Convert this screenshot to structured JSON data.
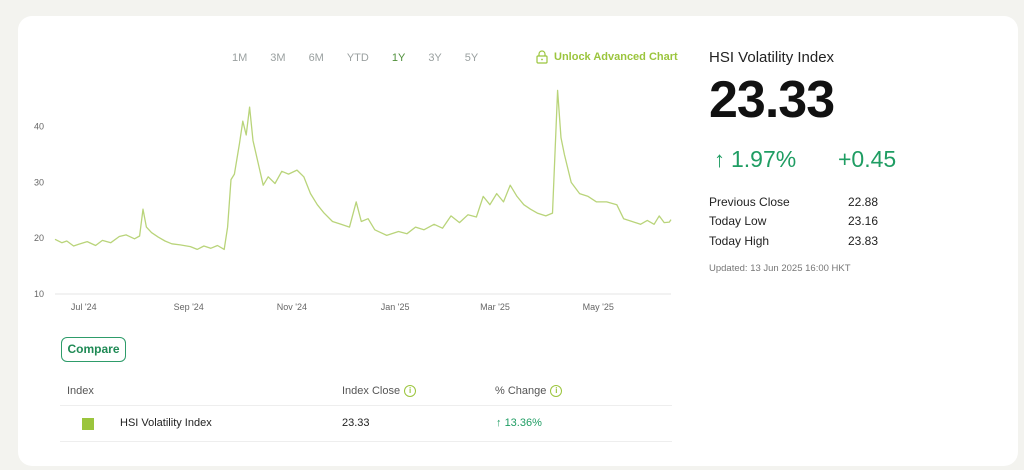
{
  "ranges": {
    "items": [
      "1M",
      "3M",
      "6M",
      "YTD",
      "1Y",
      "3Y",
      "5Y"
    ],
    "active": "1Y"
  },
  "unlock": {
    "label": "Unlock Advanced Chart",
    "icon": "lock-icon"
  },
  "compare": {
    "label": "Compare"
  },
  "table": {
    "headers": {
      "index": "Index",
      "close": "Index Close",
      "change": "% Change"
    },
    "row": {
      "name": "HSI Volatility Index",
      "close": "23.33",
      "change": "13.36%"
    }
  },
  "quote": {
    "title": "HSI Volatility Index",
    "value": "23.33",
    "change_pct": "1.97%",
    "change_abs": "+0.45",
    "stats": [
      {
        "label": "Previous Close",
        "value": "22.88"
      },
      {
        "label": "Today Low",
        "value": "23.16"
      },
      {
        "label": "Today High",
        "value": "23.83"
      }
    ],
    "updated": "Updated: 13 Jun 2025 16:00 HKT"
  },
  "colors": {
    "accent": "#9bc53d",
    "up": "#1f9d63",
    "active_range": "#4f8f3a"
  },
  "chart_data": {
    "type": "line",
    "title": "",
    "xlabel": "",
    "ylabel": "",
    "ylim": [
      10,
      48
    ],
    "xlim": [
      "2024-06-14",
      "2025-06-13"
    ],
    "yticks": [
      "10",
      "20",
      "30",
      "40"
    ],
    "xticks": [
      {
        "label": "Jul '24",
        "date": "2024-07-01"
      },
      {
        "label": "Sep '24",
        "date": "2024-09-01"
      },
      {
        "label": "Nov '24",
        "date": "2024-11-01"
      },
      {
        "label": "Jan '25",
        "date": "2025-01-01"
      },
      {
        "label": "Mar '25",
        "date": "2025-03-01"
      },
      {
        "label": "May '25",
        "date": "2025-05-01"
      }
    ],
    "series": [
      {
        "color": "#b9d47a",
        "points": [
          [
            "2024-06-14",
            19.8
          ],
          [
            "2024-06-18",
            19.2
          ],
          [
            "2024-06-21",
            19.5
          ],
          [
            "2024-06-25",
            18.6
          ],
          [
            "2024-06-28",
            18.9
          ],
          [
            "2024-07-03",
            19.4
          ],
          [
            "2024-07-08",
            18.7
          ],
          [
            "2024-07-12",
            19.6
          ],
          [
            "2024-07-17",
            19.2
          ],
          [
            "2024-07-22",
            20.3
          ],
          [
            "2024-07-26",
            20.6
          ],
          [
            "2024-07-31",
            19.9
          ],
          [
            "2024-08-03",
            20.4
          ],
          [
            "2024-08-05",
            25.2
          ],
          [
            "2024-08-07",
            22.0
          ],
          [
            "2024-08-10",
            21.0
          ],
          [
            "2024-08-14",
            20.2
          ],
          [
            "2024-08-18",
            19.5
          ],
          [
            "2024-08-22",
            19.0
          ],
          [
            "2024-08-27",
            18.8
          ],
          [
            "2024-09-02",
            18.5
          ],
          [
            "2024-09-06",
            18.0
          ],
          [
            "2024-09-10",
            18.6
          ],
          [
            "2024-09-14",
            18.2
          ],
          [
            "2024-09-18",
            18.7
          ],
          [
            "2024-09-22",
            18.0
          ],
          [
            "2024-09-24",
            22.0
          ],
          [
            "2024-09-26",
            30.5
          ],
          [
            "2024-09-28",
            31.5
          ],
          [
            "2024-10-01",
            37.0
          ],
          [
            "2024-10-03",
            41.0
          ],
          [
            "2024-10-05",
            38.5
          ],
          [
            "2024-10-07",
            43.5
          ],
          [
            "2024-10-09",
            37.5
          ],
          [
            "2024-10-12",
            33.5
          ],
          [
            "2024-10-15",
            29.5
          ],
          [
            "2024-10-18",
            31.0
          ],
          [
            "2024-10-22",
            29.8
          ],
          [
            "2024-10-26",
            32.0
          ],
          [
            "2024-10-30",
            31.5
          ],
          [
            "2024-11-04",
            32.2
          ],
          [
            "2024-11-08",
            31.0
          ],
          [
            "2024-11-12",
            28.0
          ],
          [
            "2024-11-16",
            26.0
          ],
          [
            "2024-11-20",
            24.5
          ],
          [
            "2024-11-25",
            23.0
          ],
          [
            "2024-11-30",
            22.5
          ],
          [
            "2024-12-05",
            22.0
          ],
          [
            "2024-12-09",
            26.5
          ],
          [
            "2024-12-12",
            23.0
          ],
          [
            "2024-12-16",
            23.5
          ],
          [
            "2024-12-20",
            21.5
          ],
          [
            "2024-12-27",
            20.5
          ],
          [
            "2025-01-03",
            21.2
          ],
          [
            "2025-01-08",
            20.8
          ],
          [
            "2025-01-13",
            22.0
          ],
          [
            "2025-01-18",
            21.5
          ],
          [
            "2025-01-24",
            22.5
          ],
          [
            "2025-01-29",
            21.8
          ],
          [
            "2025-02-03",
            24.0
          ],
          [
            "2025-02-08",
            22.8
          ],
          [
            "2025-02-13",
            24.2
          ],
          [
            "2025-02-18",
            23.8
          ],
          [
            "2025-02-22",
            27.5
          ],
          [
            "2025-02-26",
            26.0
          ],
          [
            "2025-03-02",
            28.0
          ],
          [
            "2025-03-06",
            26.5
          ],
          [
            "2025-03-10",
            29.5
          ],
          [
            "2025-03-14",
            27.5
          ],
          [
            "2025-03-18",
            26.0
          ],
          [
            "2025-03-22",
            25.2
          ],
          [
            "2025-03-26",
            24.5
          ],
          [
            "2025-03-31",
            24.0
          ],
          [
            "2025-04-04",
            24.5
          ],
          [
            "2025-04-07",
            46.5
          ],
          [
            "2025-04-09",
            38.0
          ],
          [
            "2025-04-11",
            35.0
          ],
          [
            "2025-04-15",
            30.0
          ],
          [
            "2025-04-20",
            28.0
          ],
          [
            "2025-04-25",
            27.5
          ],
          [
            "2025-04-30",
            26.5
          ],
          [
            "2025-05-06",
            26.5
          ],
          [
            "2025-05-12",
            26.0
          ],
          [
            "2025-05-16",
            23.5
          ],
          [
            "2025-05-21",
            23.0
          ],
          [
            "2025-05-26",
            22.5
          ],
          [
            "2025-05-30",
            23.2
          ],
          [
            "2025-06-03",
            22.5
          ],
          [
            "2025-06-06",
            24.0
          ],
          [
            "2025-06-09",
            22.8
          ],
          [
            "2025-06-12",
            22.88
          ],
          [
            "2025-06-13",
            23.33
          ]
        ]
      }
    ]
  }
}
